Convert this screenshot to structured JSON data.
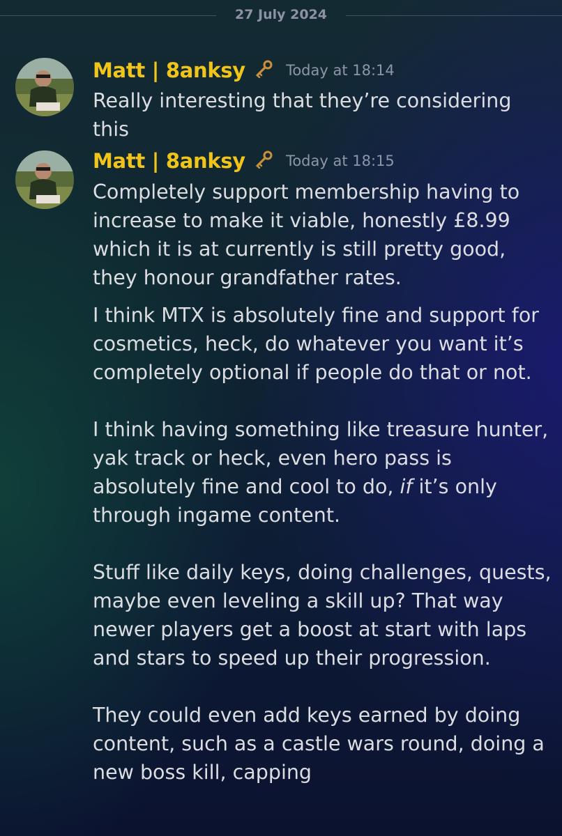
{
  "date_divider": "27 July 2024",
  "messages": [
    {
      "author": "Matt | 8anksy",
      "badge_icon": "key-icon",
      "timestamp": "Today at 18:14",
      "text": "Really interesting that they’re considering this"
    },
    {
      "author": "Matt | 8anksy",
      "badge_icon": "key-icon",
      "timestamp": "Today at 18:15",
      "paragraphs": [
        "Completely support membership having to increase to make it viable, honestly £8.99 which it is at currently is still pretty good, they honour grandfather rates.",
        "I think MTX is absolutely fine and support for cosmetics, heck, do whatever you want it’s completely optional if people do that or not.\n\nI think having something like treasure hunter, yak track or heck, even hero pass is absolutely fine and cool to do, ",
        "if",
        " it’s only through ingame content.\n\nStuff like daily keys, doing challenges, quests, maybe even leveling a skill up? That way newer players get a boost at start with laps and stars to speed up their progression.\n\nThey could even add keys earned by doing content, such as a castle wars round, doing a new boss kill, capping"
      ]
    }
  ],
  "colors": {
    "username": "#f0c419",
    "text": "#dcdde1",
    "timestamp": "#8e95a6"
  }
}
